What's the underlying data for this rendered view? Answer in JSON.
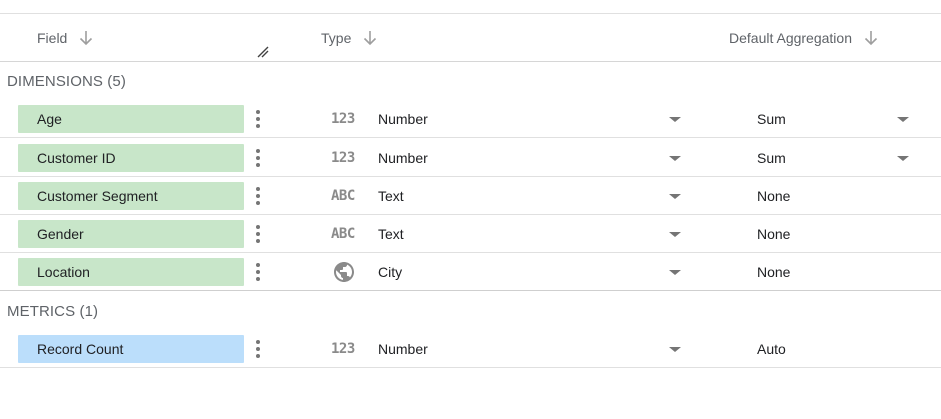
{
  "header": {
    "field_label": "Field",
    "type_label": "Type",
    "aggregation_label": "Default Aggregation"
  },
  "sections": {
    "dimensions": "DIMENSIONS (5)",
    "metrics": "METRICS (1)"
  },
  "dimensions": [
    {
      "name": "Age",
      "type_icon": "123",
      "type": "Number",
      "aggregation": "Sum"
    },
    {
      "name": "Customer ID",
      "type_icon": "123",
      "type": "Number",
      "aggregation": "Sum"
    },
    {
      "name": "Customer Segment",
      "type_icon": "ABC",
      "type": "Text",
      "aggregation": "None"
    },
    {
      "name": "Gender",
      "type_icon": "ABC",
      "type": "Text",
      "aggregation": "None"
    },
    {
      "name": "Location",
      "type_icon": "globe-icon",
      "type": "City",
      "aggregation": "None"
    }
  ],
  "metrics": [
    {
      "name": "Record Count",
      "type_icon": "123",
      "type": "Number",
      "aggregation": "Auto"
    }
  ],
  "colors": {
    "dimension_chip": "#c8e6c9",
    "metric_chip": "#bbdefb",
    "icon_gray": "#8a8a8a"
  }
}
